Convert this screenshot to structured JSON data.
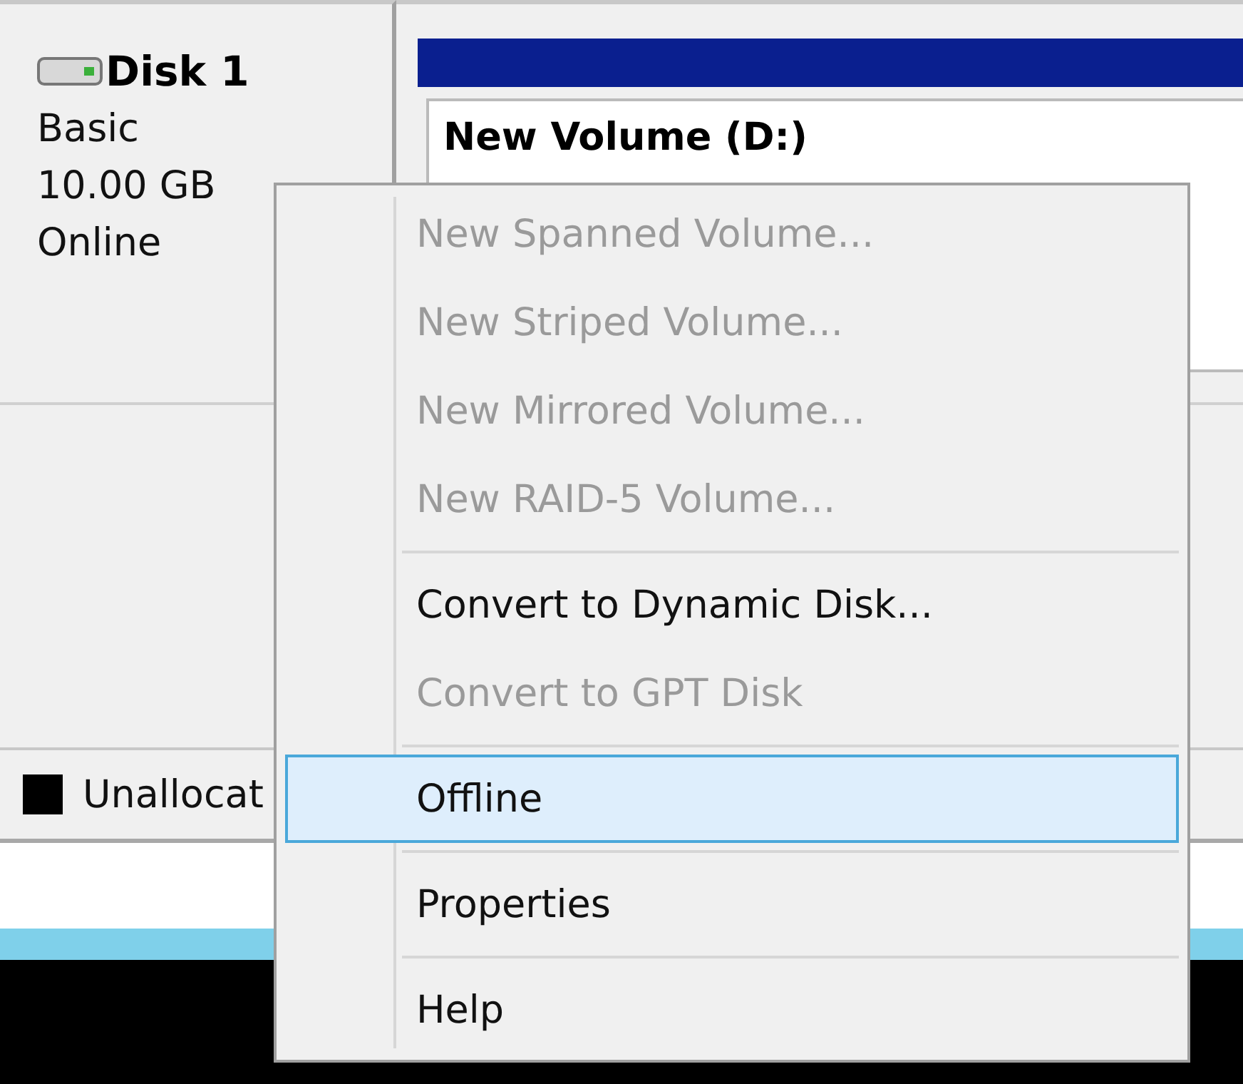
{
  "disk": {
    "name": "Disk 1",
    "type": "Basic",
    "size": "10.00 GB",
    "status": "Online"
  },
  "volume": {
    "name": "New Volume  (D:)"
  },
  "legend": [
    {
      "label": "Unallocat",
      "color": "#000000"
    }
  ],
  "context_menu": {
    "items": [
      {
        "kind": "item",
        "label": "New Spanned Volume...",
        "disabled": true,
        "selected": false
      },
      {
        "kind": "item",
        "label": "New Striped Volume...",
        "disabled": true,
        "selected": false
      },
      {
        "kind": "item",
        "label": "New Mirrored Volume...",
        "disabled": true,
        "selected": false
      },
      {
        "kind": "item",
        "label": "New RAID-5 Volume...",
        "disabled": true,
        "selected": false
      },
      {
        "kind": "separator"
      },
      {
        "kind": "item",
        "label": "Convert to Dynamic Disk...",
        "disabled": false,
        "selected": false
      },
      {
        "kind": "item",
        "label": "Convert to GPT Disk",
        "disabled": true,
        "selected": false
      },
      {
        "kind": "separator"
      },
      {
        "kind": "item",
        "label": "Offline",
        "disabled": false,
        "selected": true
      },
      {
        "kind": "separator"
      },
      {
        "kind": "item",
        "label": "Properties",
        "disabled": false,
        "selected": false
      },
      {
        "kind": "separator"
      },
      {
        "kind": "item",
        "label": "Help",
        "disabled": false,
        "selected": false
      }
    ]
  }
}
